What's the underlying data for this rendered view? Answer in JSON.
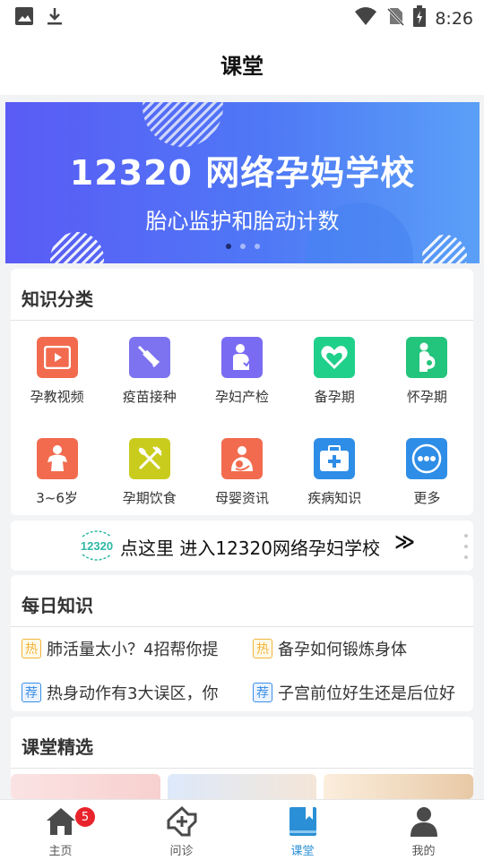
{
  "status_bar": {
    "time": "8:26",
    "icons": [
      "image-icon",
      "download-icon",
      "wifi-icon",
      "no-sim-icon",
      "battery-charging-icon"
    ]
  },
  "header": {
    "title": "课堂"
  },
  "banner": {
    "headline": "12320 网络孕妈学校",
    "subtitle": "胎心监护和胎动计数",
    "slides": 3,
    "active_slide": 1
  },
  "knowledge": {
    "title": "知识分类",
    "categories": [
      {
        "label": "孕教视频",
        "icon": "video-play-icon",
        "color": "#f26b4f"
      },
      {
        "label": "疫苗接种",
        "icon": "syringe-icon",
        "color": "#7d73f0"
      },
      {
        "label": "孕妇产检",
        "icon": "pregnant-check-icon",
        "color": "#7a6cf2"
      },
      {
        "label": "备孕期",
        "icon": "heart-icon",
        "color": "#1fd08a"
      },
      {
        "label": "怀孕期",
        "icon": "pregnant-woman-icon",
        "color": "#23c47c"
      },
      {
        "label": "3~6岁",
        "icon": "child-icon",
        "color": "#f26b4f"
      },
      {
        "label": "孕期饮食",
        "icon": "fork-knife-icon",
        "color": "#c9cc1d"
      },
      {
        "label": "母婴资讯",
        "icon": "mother-baby-icon",
        "color": "#f26b4f"
      },
      {
        "label": "疾病知识",
        "icon": "medical-kit-icon",
        "color": "#2e8de6"
      },
      {
        "label": "更多",
        "icon": "more-icon",
        "color": "#2e8de6"
      }
    ]
  },
  "entry": {
    "logo_text": "12320",
    "text": "点这里 进入12320网络孕妇学校",
    "arrow": "≫"
  },
  "daily": {
    "title": "每日知识",
    "items": [
      {
        "tag": "热",
        "type": "hot",
        "text": "肺活量太小？4招帮你提"
      },
      {
        "tag": "热",
        "type": "hot",
        "text": "备孕如何锻炼身体"
      },
      {
        "tag": "荐",
        "type": "rec",
        "text": "热身动作有3大误区，你"
      },
      {
        "tag": "荐",
        "type": "rec",
        "text": "子宫前位好生还是后位好"
      }
    ]
  },
  "featured": {
    "title": "课堂精选"
  },
  "tabbar": {
    "items": [
      {
        "label": "主页",
        "icon": "home-icon"
      },
      {
        "label": "问诊",
        "icon": "consult-icon"
      },
      {
        "label": "课堂",
        "icon": "book-icon"
      },
      {
        "label": "我的",
        "icon": "person-icon"
      }
    ],
    "badge": "5",
    "active": "课堂"
  }
}
